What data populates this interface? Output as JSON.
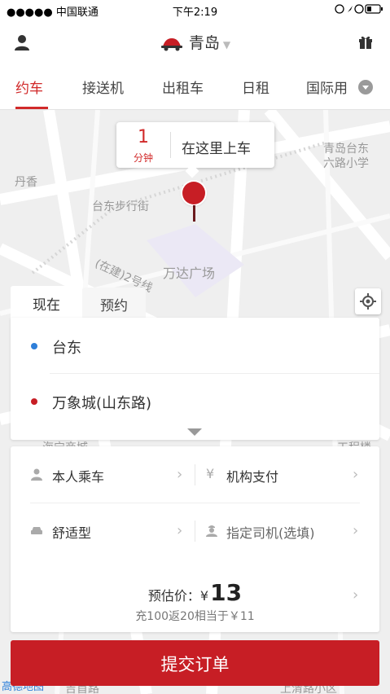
{
  "status_bar": {
    "carrier": "●●●●● 中国联通",
    "time": "下午2:19"
  },
  "header": {
    "city": "青岛"
  },
  "tabs": [
    "约车",
    "接送机",
    "出租车",
    "日租",
    "国际用"
  ],
  "map": {
    "labels": [
      "丹香",
      "台东步行街",
      "万达广场",
      "青岛台东",
      "六路小学",
      "(在建)2号线",
      "海宁商城",
      "工程楼",
      "高德地图",
      "吉首路",
      "上清路小区"
    ]
  },
  "pickup_bubble": {
    "eta": "1",
    "unit": "分钟",
    "text": "在这里上车"
  },
  "booking_tabs": {
    "now": "现在",
    "reserve": "预约"
  },
  "address": {
    "from": "台东",
    "to": "万象城(山东路)"
  },
  "options": {
    "passenger": "本人乘车",
    "payment": "机构支付",
    "car_type": "舒适型",
    "driver": "指定司机(选填)"
  },
  "price": {
    "label": "预估价：",
    "currency": "¥",
    "amount": "13",
    "promo": "充100返20相当于￥11"
  },
  "submit_label": "提交订单",
  "colors": {
    "brand": "#c71e25",
    "from_dot": "#2e7fd9"
  }
}
